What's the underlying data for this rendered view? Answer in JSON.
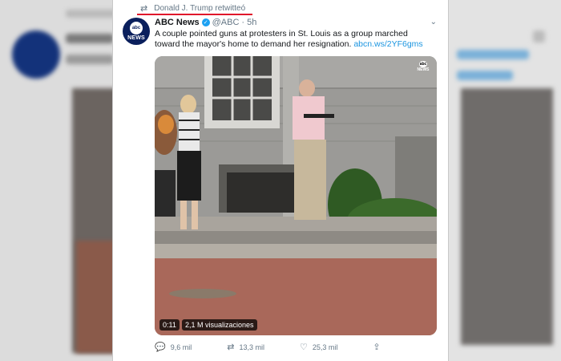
{
  "retweet": {
    "icon": "retweet-icon",
    "text": "Donald J. Trump retwitteó"
  },
  "tweet": {
    "name": "ABC News",
    "handle": "@ABC",
    "separator": "·",
    "time": "5h",
    "text": "A couple pointed guns at protesters in St. Louis as a group marched toward the mayor's home to demand her resignation.",
    "link": "abcn.ws/2YF6gms",
    "avatar_text_top": "abc",
    "avatar_text_bottom": "NEWS"
  },
  "video": {
    "duration": "0:11",
    "views": "2,1 M visualizaciones",
    "bug_top": "abc",
    "bug_bottom": "NEWS"
  },
  "actions": {
    "reply_count": "9,6 mil",
    "retweet_count": "13,3 mil",
    "like_count": "25,3 mil"
  },
  "colors": {
    "accent": "#1da1f2",
    "link": "#1b95e0",
    "underline": "#e0162b"
  }
}
